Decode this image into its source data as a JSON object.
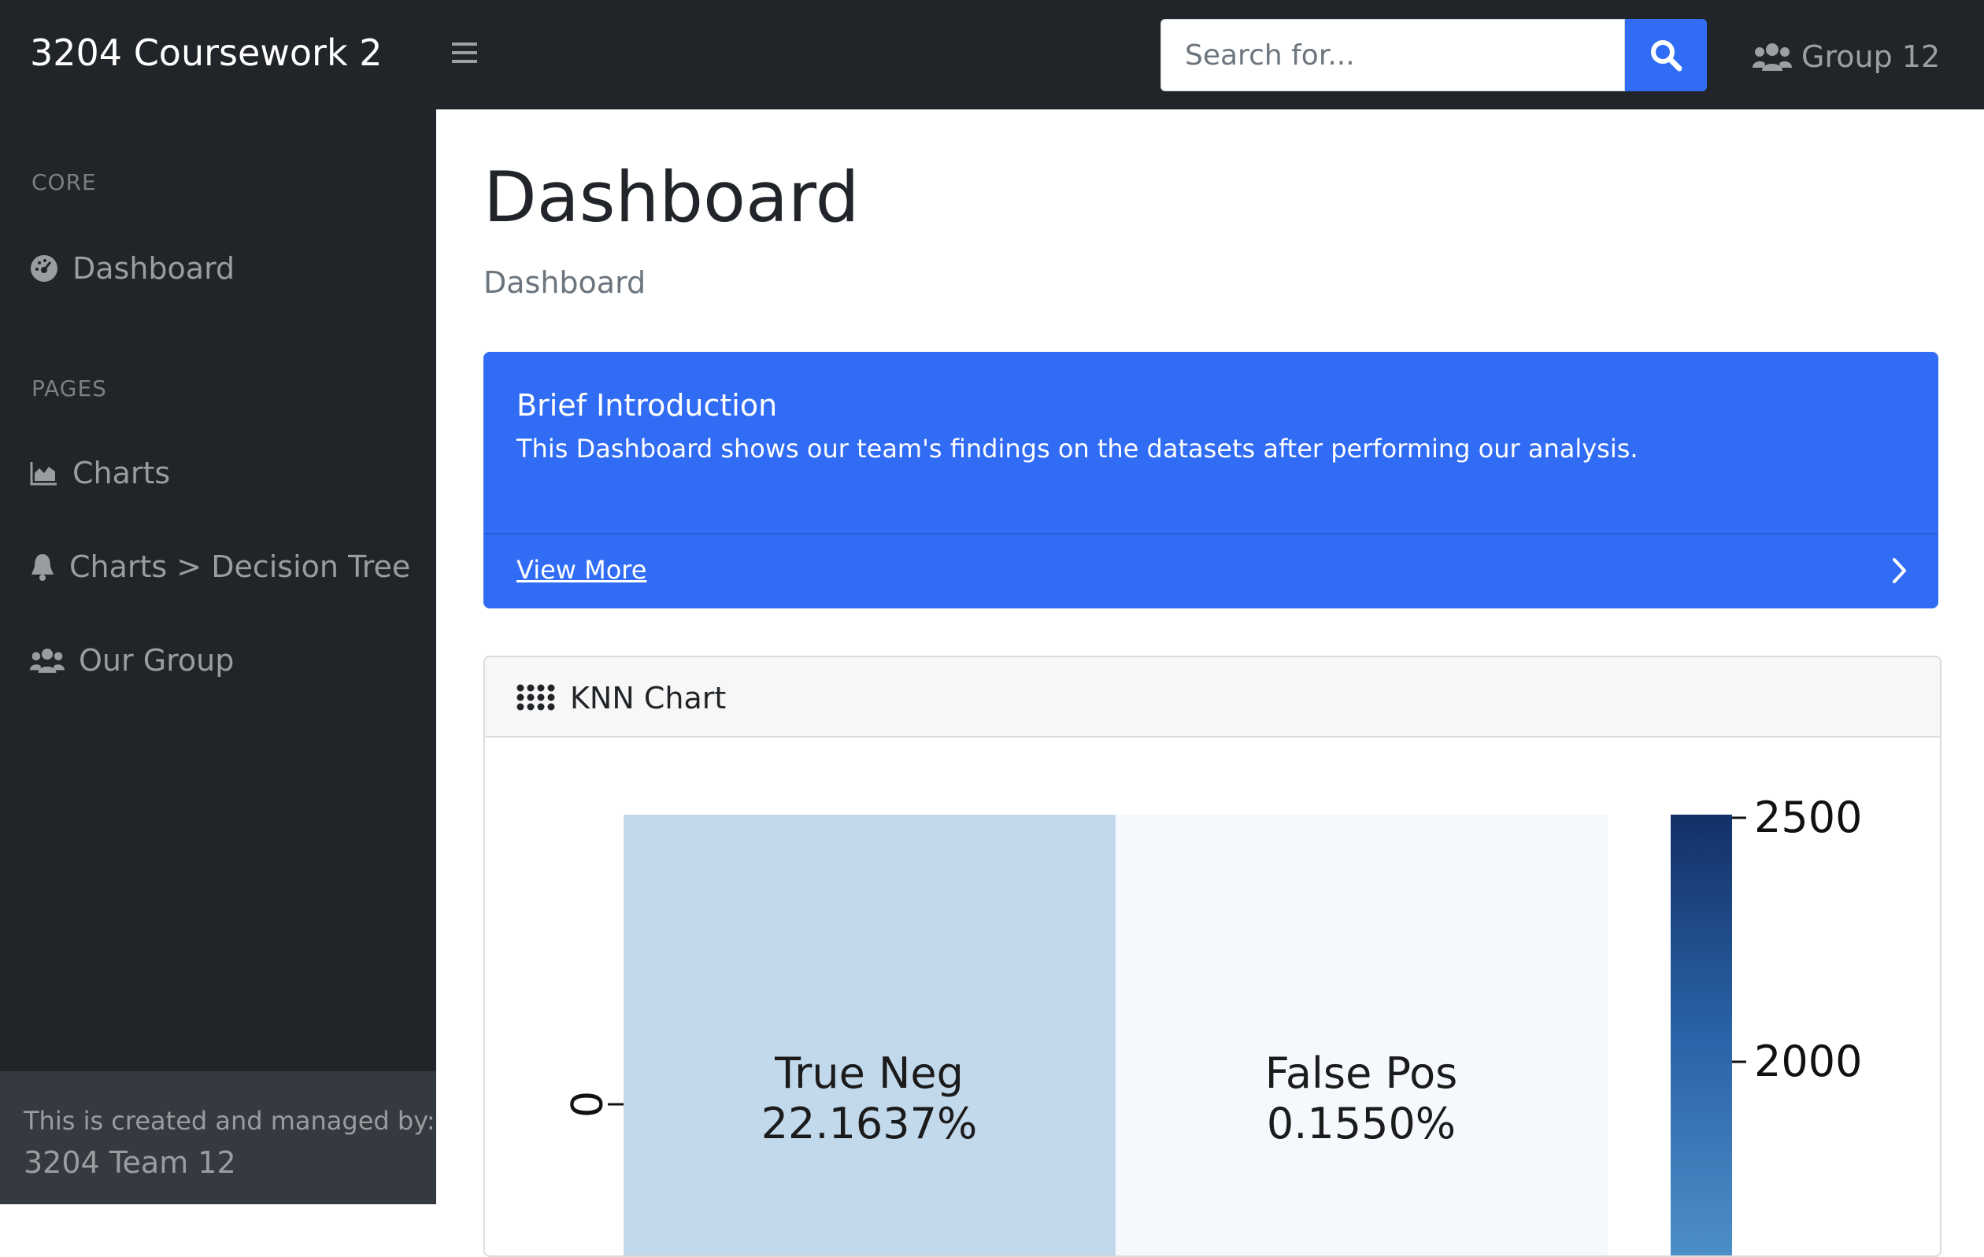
{
  "navbar": {
    "brand": "3204 Coursework 2",
    "search_placeholder": "Search for...",
    "user_label": "Group 12"
  },
  "sidebar": {
    "core_heading": "CORE",
    "pages_heading": "PAGES",
    "items": [
      {
        "label": "Dashboard",
        "icon": "tachometer-icon"
      },
      {
        "label": "Charts",
        "icon": "area-chart-icon"
      },
      {
        "label": "Charts > Decision Tree",
        "icon": "bell-icon"
      },
      {
        "label": "Our Group",
        "icon": "users-icon"
      }
    ],
    "footer_caption": "This is created and managed by:",
    "footer_name": "3204 Team 12"
  },
  "main": {
    "title": "Dashboard",
    "breadcrumb": "Dashboard",
    "intro_card": {
      "title": "Brief Introduction",
      "text": "This Dashboard shows our team's findings on the datasets after performing our analysis.",
      "link": "View More"
    },
    "knn_card": {
      "title": "KNN Chart"
    }
  },
  "colors": {
    "navbar_bg": "#212529",
    "primary": "#316cf4",
    "sidebar_footer_bg": "#343a40"
  },
  "chart_data": {
    "type": "heatmap",
    "rows": [
      "0"
    ],
    "cells": [
      {
        "name": "True Neg",
        "percent": "22.1637%",
        "row": "0",
        "col": 0
      },
      {
        "name": "False Pos",
        "percent": "0.1550%",
        "row": "0",
        "col": 1
      }
    ],
    "colorbar": {
      "ticks": [
        2500,
        2000
      ],
      "colormap": "Blues"
    }
  }
}
